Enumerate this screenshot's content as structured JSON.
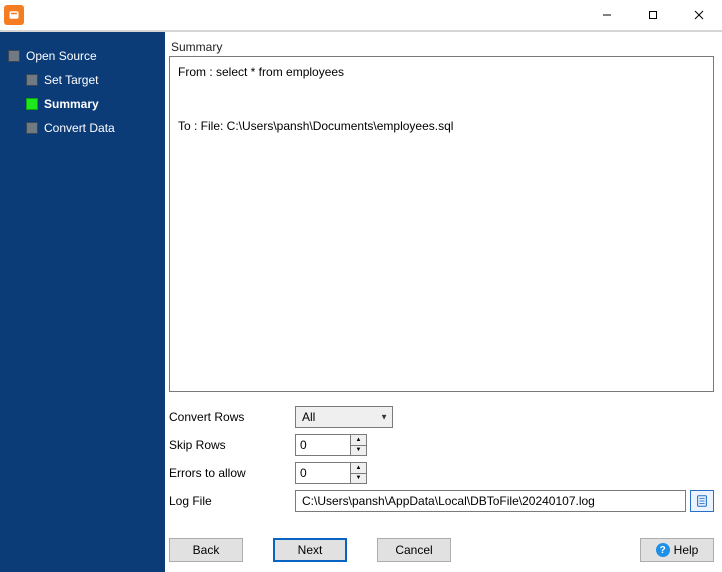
{
  "sidebar": {
    "items": [
      {
        "label": "Open Source",
        "child": false,
        "active": false
      },
      {
        "label": "Set Target",
        "child": true,
        "active": false
      },
      {
        "label": "Summary",
        "child": true,
        "active": true
      },
      {
        "label": "Convert Data",
        "child": true,
        "active": false
      }
    ]
  },
  "main": {
    "group_label": "Summary",
    "summary_text": "From : select * from employees\n\n\nTo : File: C:\\Users\\pansh\\Documents\\employees.sql"
  },
  "form": {
    "convert_rows_label": "Convert Rows",
    "convert_rows_value": "All",
    "skip_rows_label": "Skip Rows",
    "skip_rows_value": "0",
    "errors_label": "Errors to allow",
    "errors_value": "0",
    "log_label": "Log File",
    "log_value": "C:\\Users\\pansh\\AppData\\Local\\DBToFile\\20240107.log"
  },
  "buttons": {
    "back": "Back",
    "next": "Next",
    "cancel": "Cancel",
    "help": "Help"
  }
}
